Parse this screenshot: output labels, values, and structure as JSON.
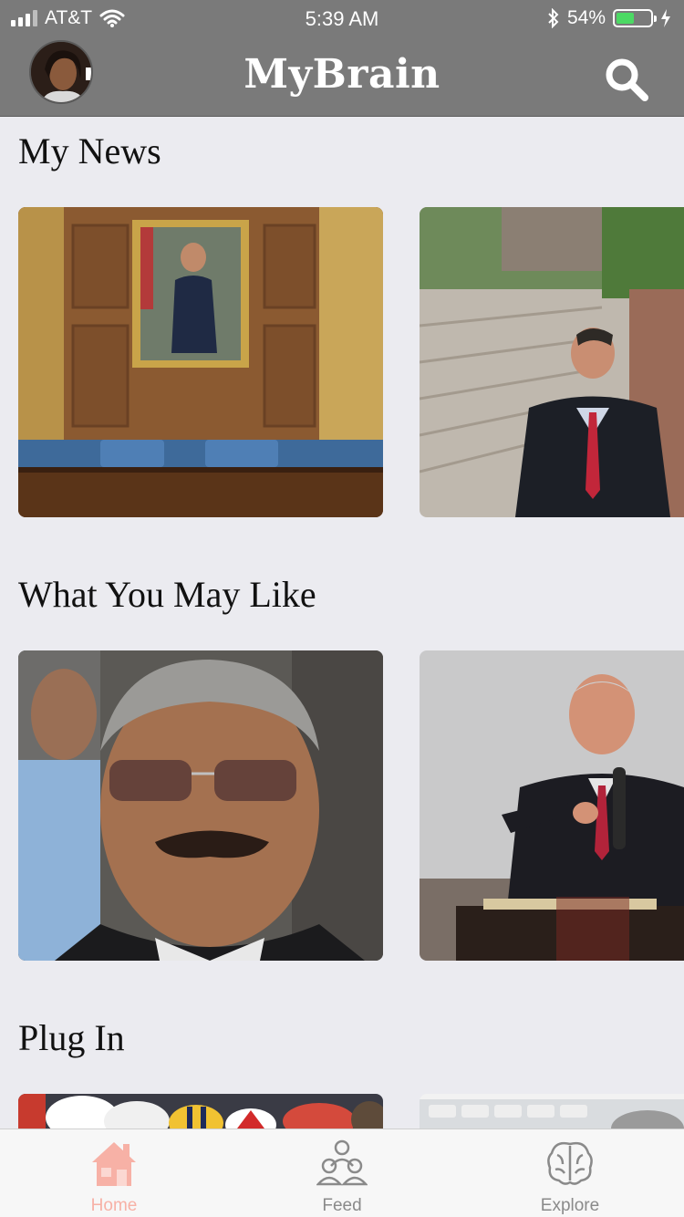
{
  "status_bar": {
    "carrier": "AT&T",
    "time": "5:39 AM",
    "battery": "54%"
  },
  "header": {
    "title": "MyBrain"
  },
  "sections": [
    {
      "title": "My News"
    },
    {
      "title": "What You May Like"
    },
    {
      "title": "Plug In"
    }
  ],
  "tabbar": {
    "items": [
      {
        "label": "Home",
        "icon": "house-icon",
        "active": true
      },
      {
        "label": "Feed",
        "icon": "people-icon",
        "active": false
      },
      {
        "label": "Explore",
        "icon": "brain-icon",
        "active": false
      }
    ]
  },
  "colors": {
    "header_bg": "#7a7a7a",
    "page_bg": "#ebebf0",
    "active_tab": "#f7b1a6",
    "inactive_tab": "#8a8a8a"
  }
}
